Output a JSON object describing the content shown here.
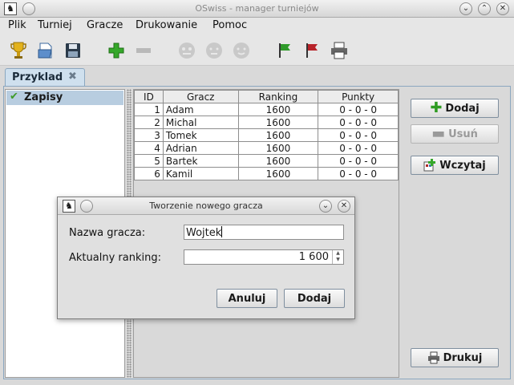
{
  "window": {
    "title": "OSwiss - manager turniejów"
  },
  "menu": {
    "items": [
      "Plik",
      "Turniej",
      "Gracze",
      "Drukowanie",
      "Pomoc"
    ]
  },
  "toolbar": {
    "icons": [
      "trophy-icon",
      "open-file-icon",
      "save-icon",
      "add-icon",
      "remove-icon",
      "face-icon-1",
      "face-icon-2",
      "face-icon-3",
      "green-flag-icon",
      "red-flag-icon",
      "printer-icon"
    ]
  },
  "tab": {
    "label": "Przyklad",
    "close_glyph": "✖"
  },
  "sidebar": {
    "items": [
      {
        "label": "Zapisy",
        "selected": true
      }
    ]
  },
  "players_table": {
    "headers": [
      "ID",
      "Gracz",
      "Ranking",
      "Punkty"
    ],
    "rows": [
      [
        "1",
        "Adam",
        "1600",
        "0 - 0 - 0"
      ],
      [
        "2",
        "Michal",
        "1600",
        "0 - 0 - 0"
      ],
      [
        "3",
        "Tomek",
        "1600",
        "0 - 0 - 0"
      ],
      [
        "4",
        "Adrian",
        "1600",
        "0 - 0 - 0"
      ],
      [
        "5",
        "Bartek",
        "1600",
        "0 - 0 - 0"
      ],
      [
        "6",
        "Kamil",
        "1600",
        "0 - 0 - 0"
      ]
    ]
  },
  "actions": {
    "add": "Dodaj",
    "remove": "Usuń",
    "load": "Wczytaj",
    "print": "Drukuj"
  },
  "dialog": {
    "title": "Tworzenie nowego gracza",
    "name_label": "Nazwa gracza:",
    "name_value": "Wojtek",
    "ranking_label": "Aktualny ranking:",
    "ranking_value": "1 600",
    "cancel": "Anuluj",
    "confirm": "Dodaj"
  },
  "colors": {
    "accent": "#b8cde0",
    "add_green": "#2e9b22",
    "check_green": "#3f9b28"
  }
}
